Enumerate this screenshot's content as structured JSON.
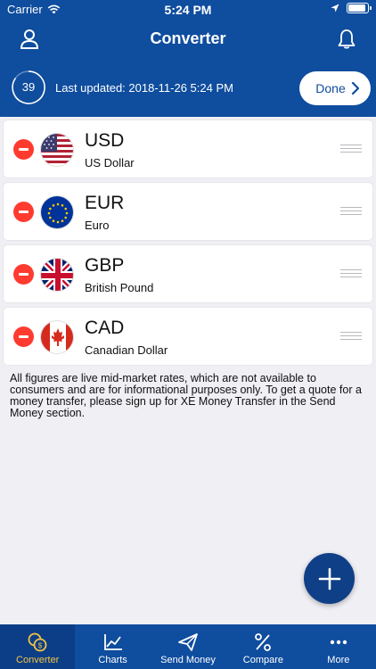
{
  "status_bar": {
    "carrier": "Carrier",
    "time": "5:24 PM"
  },
  "header": {
    "title": "Converter"
  },
  "update": {
    "countdown": "39",
    "last_updated": "Last updated: 2018-11-26 5:24 PM",
    "done_label": "Done"
  },
  "currencies": [
    {
      "code": "USD",
      "name": "US Dollar"
    },
    {
      "code": "EUR",
      "name": "Euro"
    },
    {
      "code": "GBP",
      "name": "British Pound"
    },
    {
      "code": "CAD",
      "name": "Canadian Dollar"
    }
  ],
  "disclaimer": "All figures are live mid-market rates, which are not available to consumers and are for informational purposes only. To get a quote for a money transfer, please sign up for XE Money Transfer in the Send Money section.",
  "tabs": [
    {
      "label": "Converter",
      "icon": "coins-icon",
      "active": true
    },
    {
      "label": "Charts",
      "icon": "chart-icon",
      "active": false
    },
    {
      "label": "Send Money",
      "icon": "send-icon",
      "active": false
    },
    {
      "label": "Compare",
      "icon": "percent-icon",
      "active": false
    },
    {
      "label": "More",
      "icon": "more-icon",
      "active": false
    }
  ],
  "colors": {
    "header": "#0f4d9e",
    "active_tab": "#f6c244",
    "remove": "#ff3b30",
    "fab": "#0f3f86"
  }
}
